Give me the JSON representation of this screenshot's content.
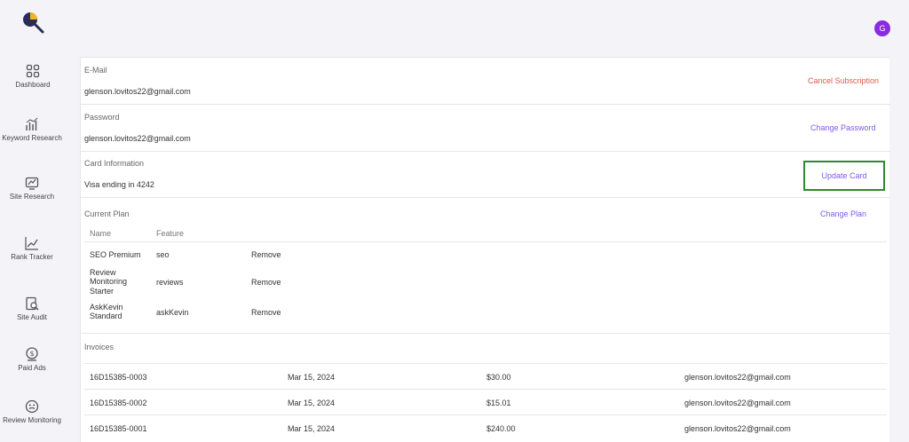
{
  "nav": {
    "items": [
      {
        "label": "Dashboard",
        "icon": "dashboard-icon"
      },
      {
        "label": "Keyword Research",
        "icon": "keyword-chart-icon"
      },
      {
        "label": "Site Research",
        "icon": "site-research-icon"
      },
      {
        "label": "Rank Tracker",
        "icon": "rank-tracker-icon"
      },
      {
        "label": "Site Audit",
        "icon": "site-audit-icon"
      },
      {
        "label": "Paid Ads",
        "icon": "paid-ads-icon"
      },
      {
        "label": "Review Monitoring",
        "icon": "review-monitoring-icon"
      }
    ]
  },
  "user": {
    "avatar_initial": "G"
  },
  "email": {
    "label": "E-Mail",
    "value": "glenson.lovitos22@gmail.com",
    "action": "Cancel Subscription"
  },
  "password": {
    "label": "Password",
    "value": "glenson.lovitos22@gmail.com",
    "action": "Change Password"
  },
  "card": {
    "label": "Card Information",
    "value": "Visa ending in 4242",
    "action": "Update Card"
  },
  "plan": {
    "label": "Current Plan",
    "action": "Change Plan",
    "columns": [
      "Name",
      "Feature"
    ],
    "rows": [
      {
        "name": "SEO Premium",
        "feature": "seo",
        "action": "Remove"
      },
      {
        "name": "Review Monitoring Starter",
        "feature": "reviews",
        "action": "Remove"
      },
      {
        "name": "AskKevin Standard",
        "feature": "askKevin",
        "action": "Remove"
      }
    ]
  },
  "invoices": {
    "label": "Invoices",
    "rows": [
      {
        "id": "16D15385-0003",
        "date": "Mar 15, 2024",
        "amount": "$30.00",
        "email": "glenson.lovitos22@gmail.com"
      },
      {
        "id": "16D15385-0002",
        "date": "Mar 15, 2024",
        "amount": "$15.01",
        "email": "glenson.lovitos22@gmail.com"
      },
      {
        "id": "16D15385-0001",
        "date": "Mar 15, 2024",
        "amount": "$240.00",
        "email": "glenson.lovitos22@gmail.com"
      }
    ]
  },
  "colors": {
    "accent": "#7b5be6",
    "danger": "#e05a4a",
    "avatar": "#8a2be2",
    "highlight": "#2d8a2d"
  }
}
